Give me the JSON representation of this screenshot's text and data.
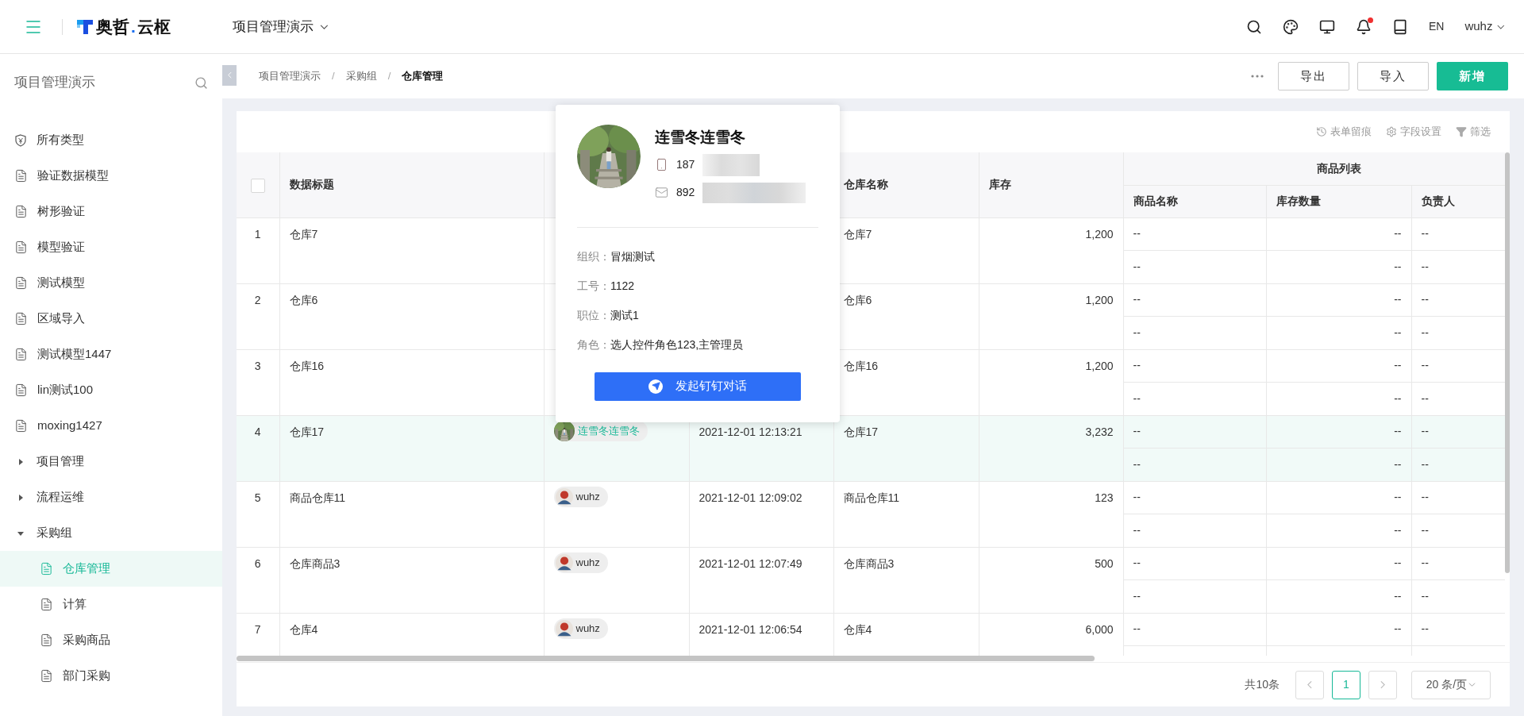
{
  "header": {
    "logo": {
      "name": "奥哲",
      "dot": ".",
      "suffix": "云枢"
    },
    "project_selector": "项目管理演示",
    "notification_unread": true,
    "language": "EN",
    "user": "wuhz"
  },
  "sidebar": {
    "title": "项目管理演示",
    "items": [
      {
        "label": "所有类型",
        "kind": "category",
        "selected": false
      },
      {
        "label": "验证数据模型",
        "kind": "model",
        "selected": false
      },
      {
        "label": "树形验证",
        "kind": "model",
        "selected": false
      },
      {
        "label": "模型验证",
        "kind": "model",
        "selected": false
      },
      {
        "label": "测试模型",
        "kind": "model",
        "selected": false
      },
      {
        "label": "区域导入",
        "kind": "model",
        "selected": false
      },
      {
        "label": "测试模型1447",
        "kind": "model",
        "selected": false
      },
      {
        "label": "lin测试100",
        "kind": "model",
        "selected": false
      },
      {
        "label": "moxing1427",
        "kind": "model",
        "selected": false
      },
      {
        "label": "项目管理",
        "kind": "folder",
        "expanded": false,
        "selected": false
      },
      {
        "label": "流程运维",
        "kind": "folder",
        "expanded": false,
        "selected": false
      },
      {
        "label": "采购组",
        "kind": "folder",
        "expanded": true,
        "selected": false,
        "children": [
          {
            "label": "仓库管理",
            "kind": "model",
            "selected": true
          },
          {
            "label": "计算",
            "kind": "model",
            "selected": false
          },
          {
            "label": "采购商品",
            "kind": "model",
            "selected": false
          },
          {
            "label": "部门采购",
            "kind": "model",
            "selected": false
          }
        ]
      }
    ]
  },
  "breadcrumbs": [
    {
      "label": "项目管理演示",
      "current": false
    },
    {
      "separator": "/",
      "label": "采购组",
      "current": false
    },
    {
      "separator": "/",
      "label": "仓库管理",
      "current": true
    }
  ],
  "actions": [
    {
      "label": "导出",
      "kind": "default"
    },
    {
      "label": "导入",
      "kind": "default"
    },
    {
      "label": "新增",
      "kind": "primary"
    }
  ],
  "toolbar": [
    {
      "label": "表单留痕",
      "kind": "history"
    },
    {
      "label": "字段设置",
      "kind": "settings"
    },
    {
      "label": "筛选",
      "kind": "filter"
    }
  ],
  "table": {
    "select_all": {
      "checked": false
    },
    "header": {
      "title": "数据标题",
      "warehouse_name": "仓库名称",
      "stock": "库存",
      "goods_group": "商品列表",
      "goods_columns": [
        "商品名称",
        "库存数量",
        "负责人"
      ]
    },
    "rows": [
      {
        "index": "1",
        "title": "仓库7",
        "warehouse_name": "仓库7",
        "stock": "1,200",
        "highlighted": false,
        "goods": [
          [
            "--",
            "--",
            "--"
          ],
          [
            "--",
            "--",
            "--"
          ]
        ]
      },
      {
        "index": "2",
        "title": "仓库6",
        "warehouse_name": "仓库6",
        "stock": "1,200",
        "highlighted": false,
        "goods": [
          [
            "--",
            "--",
            "--"
          ],
          [
            "--",
            "--",
            "--"
          ]
        ]
      },
      {
        "index": "3",
        "title": "仓库16",
        "warehouse_name": "仓库16",
        "stock": "1,200",
        "highlighted": false,
        "goods": [
          [
            "--",
            "--",
            "--"
          ],
          [
            "--",
            "--",
            "--"
          ]
        ]
      },
      {
        "index": "4",
        "title": "仓库17",
        "creator": {
          "name": "连雪冬连雪冬"
        },
        "created_at": "2021-12-01 12:13:21",
        "warehouse_name": "仓库17",
        "stock": "3,232",
        "highlighted": true,
        "goods": [
          [
            "--",
            "--",
            "--"
          ],
          [
            "--",
            "--",
            "--"
          ]
        ]
      },
      {
        "index": "5",
        "title": "商品仓库11",
        "creator": {
          "name": "wuhz",
          "kind": "figure"
        },
        "created_at": "2021-12-01 12:09:02",
        "warehouse_name": "商品仓库11",
        "stock": "123",
        "highlighted": false,
        "goods": [
          [
            "--",
            "--",
            "--"
          ],
          [
            "--",
            "--",
            "--"
          ]
        ]
      },
      {
        "index": "6",
        "title": "仓库商品3",
        "creator": {
          "name": "wuhz",
          "kind": "figure"
        },
        "created_at": "2021-12-01 12:07:49",
        "warehouse_name": "仓库商品3",
        "stock": "500",
        "highlighted": false,
        "goods": [
          [
            "--",
            "--",
            "--"
          ],
          [
            "--",
            "--",
            "--"
          ]
        ]
      },
      {
        "index": "7",
        "title": "仓库4",
        "creator": {
          "name": "wuhz",
          "kind": "figure"
        },
        "created_at": "2021-12-01 12:06:54",
        "warehouse_name": "仓库4",
        "stock": "6,000",
        "highlighted": false,
        "goods": [
          [
            "--",
            "--",
            "--"
          ]
        ]
      }
    ]
  },
  "popup": {
    "name": "连雪冬连雪冬",
    "phone": "187",
    "email": "892",
    "redacted": true,
    "fields": [
      {
        "label": "组织：",
        "value": "冒烟测试"
      },
      {
        "label": "工号：",
        "value": "1122"
      },
      {
        "label": "职位：",
        "value": "测试1"
      },
      {
        "label": "角色：",
        "value": "选人控件角色123,主管理员"
      }
    ],
    "button": "发起钉钉对话"
  },
  "pagination": {
    "total": "共10条",
    "pages": [
      {
        "label": "1",
        "selected": true
      }
    ],
    "page_size": "20 条/页"
  }
}
